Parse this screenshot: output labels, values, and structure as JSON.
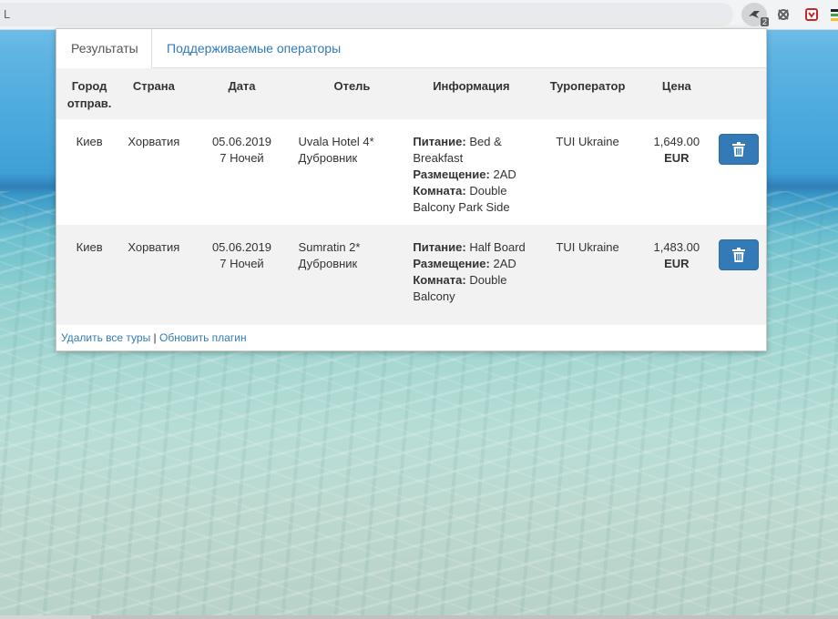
{
  "browser": {
    "url_fragment": "L",
    "extension_badge": "2"
  },
  "tabs": [
    {
      "label": "Результаты"
    },
    {
      "label": "Поддерживаемые операторы"
    }
  ],
  "table": {
    "headers": {
      "city": "Город отправ.",
      "country": "Страна",
      "date": "Дата",
      "hotel": "Отель",
      "info": "Информация",
      "operator": "Туроператор",
      "price": "Цена"
    },
    "rows": [
      {
        "city": "Киев",
        "country": "Хорватия",
        "date": "05.06.2019",
        "nights": "7 Ночей",
        "hotel": "Uvala Hotel 4*",
        "location": "Дубровник",
        "meal_label": "Питание:",
        "meal": "Bed & Breakfast",
        "accom_label": "Размещение:",
        "accom": "2AD",
        "room_label": "Комната:",
        "room": "Double Balcony Park Side",
        "operator": "TUI Ukraine",
        "price": "1,649.00",
        "currency": "EUR"
      },
      {
        "city": "Киев",
        "country": "Хорватия",
        "date": "05.06.2019",
        "nights": "7 Ночей",
        "hotel": "Sumratin 2*",
        "location": "Дубровник",
        "meal_label": "Питание:",
        "meal": "Half Board",
        "accom_label": "Размещение:",
        "accom": "2AD",
        "room_label": "Комната:",
        "room": "Double Balcony",
        "operator": "TUI Ukraine",
        "price": "1,483.00",
        "currency": "EUR"
      }
    ]
  },
  "footer": {
    "delete_all": "Удалить все туры",
    "separator": "|",
    "refresh": "Обновить плагин"
  },
  "colors": {
    "accent": "#337ab7",
    "row_alt": "#f2f2f2"
  }
}
